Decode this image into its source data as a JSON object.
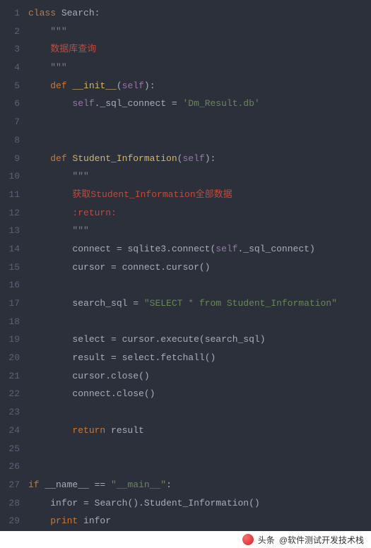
{
  "lines": [
    {
      "n": 1,
      "tokens": [
        [
          "kw",
          "class "
        ],
        [
          "cls",
          "Search"
        ],
        [
          "op",
          ":"
        ]
      ]
    },
    {
      "n": 2,
      "indent": 1,
      "tokens": [
        [
          "doc",
          "\"\"\""
        ]
      ]
    },
    {
      "n": 3,
      "indent": 1,
      "tokens": [
        [
          "red",
          "数据库查询"
        ]
      ]
    },
    {
      "n": 4,
      "indent": 1,
      "tokens": [
        [
          "doc",
          "\"\"\""
        ]
      ]
    },
    {
      "n": 5,
      "indent": 1,
      "tokens": [
        [
          "kw",
          "def "
        ],
        [
          "fn",
          "__init__"
        ],
        [
          "op",
          "("
        ],
        [
          "self",
          "self"
        ],
        [
          "op",
          "):"
        ]
      ]
    },
    {
      "n": 6,
      "indent": 2,
      "tokens": [
        [
          "self",
          "self"
        ],
        [
          "op",
          "."
        ],
        [
          "id",
          "_sql_connect"
        ],
        [
          "op",
          " = "
        ],
        [
          "str",
          "'Dm_Result.db'"
        ]
      ]
    },
    {
      "n": 7,
      "tokens": []
    },
    {
      "n": 8,
      "tokens": []
    },
    {
      "n": 9,
      "indent": 1,
      "tokens": [
        [
          "kw",
          "def "
        ],
        [
          "fn",
          "Student_Information"
        ],
        [
          "op",
          "("
        ],
        [
          "self",
          "self"
        ],
        [
          "op",
          "):"
        ]
      ]
    },
    {
      "n": 10,
      "indent": 2,
      "tokens": [
        [
          "doc",
          "\"\"\""
        ]
      ]
    },
    {
      "n": 11,
      "indent": 2,
      "tokens": [
        [
          "red",
          "获取Student_Information全部数据"
        ]
      ]
    },
    {
      "n": 12,
      "indent": 2,
      "tokens": [
        [
          "red",
          ":return:"
        ]
      ]
    },
    {
      "n": 13,
      "indent": 2,
      "tokens": [
        [
          "doc",
          "\"\"\""
        ]
      ]
    },
    {
      "n": 14,
      "indent": 2,
      "tokens": [
        [
          "id",
          "connect"
        ],
        [
          "op",
          " = "
        ],
        [
          "id",
          "sqlite3"
        ],
        [
          "op",
          "."
        ],
        [
          "id",
          "connect"
        ],
        [
          "op",
          "("
        ],
        [
          "self",
          "self"
        ],
        [
          "op",
          "."
        ],
        [
          "id",
          "_sql_connect"
        ],
        [
          "op",
          ")"
        ]
      ]
    },
    {
      "n": 15,
      "indent": 2,
      "tokens": [
        [
          "id",
          "cursor"
        ],
        [
          "op",
          " = "
        ],
        [
          "id",
          "connect"
        ],
        [
          "op",
          "."
        ],
        [
          "id",
          "cursor"
        ],
        [
          "op",
          "()"
        ]
      ]
    },
    {
      "n": 16,
      "tokens": []
    },
    {
      "n": 17,
      "indent": 2,
      "tokens": [
        [
          "id",
          "search_sql"
        ],
        [
          "op",
          " = "
        ],
        [
          "str",
          "\"SELECT * from Student_Information\""
        ]
      ]
    },
    {
      "n": 18,
      "tokens": []
    },
    {
      "n": 19,
      "indent": 2,
      "tokens": [
        [
          "id",
          "select"
        ],
        [
          "op",
          " = "
        ],
        [
          "id",
          "cursor"
        ],
        [
          "op",
          "."
        ],
        [
          "id",
          "execute"
        ],
        [
          "op",
          "("
        ],
        [
          "id",
          "search_sql"
        ],
        [
          "op",
          ")"
        ]
      ]
    },
    {
      "n": 20,
      "indent": 2,
      "tokens": [
        [
          "id",
          "result"
        ],
        [
          "op",
          " = "
        ],
        [
          "id",
          "select"
        ],
        [
          "op",
          "."
        ],
        [
          "id",
          "fetchall"
        ],
        [
          "op",
          "()"
        ]
      ]
    },
    {
      "n": 21,
      "indent": 2,
      "tokens": [
        [
          "id",
          "cursor"
        ],
        [
          "op",
          "."
        ],
        [
          "id",
          "close"
        ],
        [
          "op",
          "()"
        ]
      ]
    },
    {
      "n": 22,
      "indent": 2,
      "tokens": [
        [
          "id",
          "connect"
        ],
        [
          "op",
          "."
        ],
        [
          "id",
          "close"
        ],
        [
          "op",
          "()"
        ]
      ]
    },
    {
      "n": 23,
      "tokens": []
    },
    {
      "n": 24,
      "indent": 2,
      "tokens": [
        [
          "kw",
          "return "
        ],
        [
          "id",
          "result"
        ]
      ]
    },
    {
      "n": 25,
      "tokens": []
    },
    {
      "n": 26,
      "tokens": []
    },
    {
      "n": 27,
      "tokens": [
        [
          "kw",
          "if "
        ],
        [
          "id",
          "__name__"
        ],
        [
          "op",
          " == "
        ],
        [
          "str",
          "\"__main__\""
        ],
        [
          "op",
          ":"
        ]
      ]
    },
    {
      "n": 28,
      "indent": 1,
      "tokens": [
        [
          "id",
          "infor"
        ],
        [
          "op",
          " = "
        ],
        [
          "id",
          "Search"
        ],
        [
          "op",
          "()."
        ],
        [
          "id",
          "Student_Information"
        ],
        [
          "op",
          "()"
        ]
      ]
    },
    {
      "n": 29,
      "indent": 1,
      "tokens": [
        [
          "kw",
          "print "
        ],
        [
          "id",
          "infor"
        ]
      ]
    }
  ],
  "footer": {
    "source_label": "头条",
    "author": "@软件测试开发技术栈"
  }
}
